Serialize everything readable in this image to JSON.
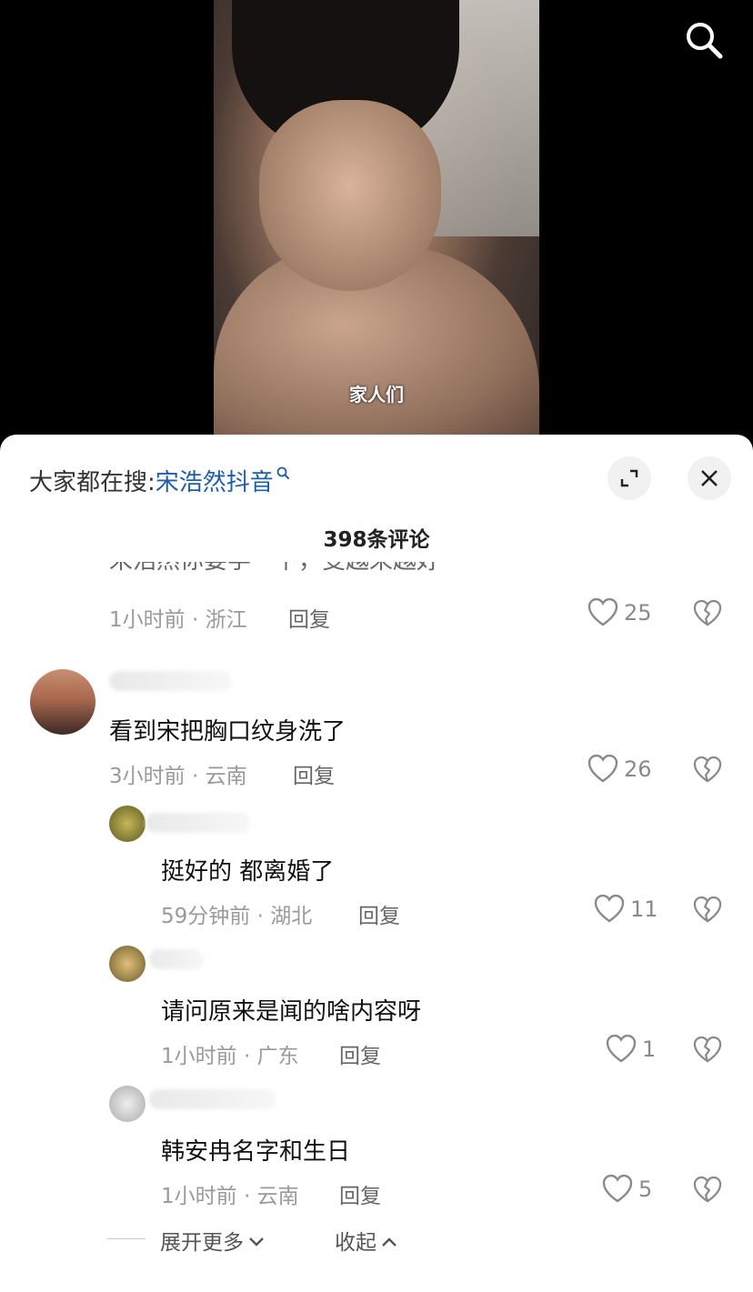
{
  "video": {
    "subtitle": "家人们"
  },
  "sheet": {
    "search_prefix": "大家都在搜:",
    "search_keyword": "宋浩然抖音",
    "comment_count": "398条评论",
    "cut_comment_text": "宋浩然你要学一下，变越来越好"
  },
  "comments": [
    {
      "meta": "1小时前 · 浙江",
      "reply": "回复",
      "likes": "25"
    },
    {
      "text": "看到宋把胸口纹身洗了",
      "meta": "3小时前 · 云南",
      "reply": "回复",
      "likes": "26"
    },
    {
      "text": "挺好的  都离婚了",
      "meta": "59分钟前 · 湖北",
      "reply": "回复",
      "likes": "11"
    },
    {
      "text": "请问原来是闻的啥内容呀",
      "meta": "1小时前 · 广东",
      "reply": "回复",
      "likes": "1"
    },
    {
      "text": "韩安冉名字和生日",
      "meta": "1小时前 · 云南",
      "reply": "回复",
      "likes": "5"
    }
  ],
  "footer": {
    "expand_more": "展开更多",
    "collapse": "收起"
  },
  "icons": [
    "search-icon",
    "fullscreen-icon",
    "close-icon",
    "heart-icon",
    "broken-heart-icon",
    "chevron-down-icon",
    "chevron-up-icon"
  ]
}
